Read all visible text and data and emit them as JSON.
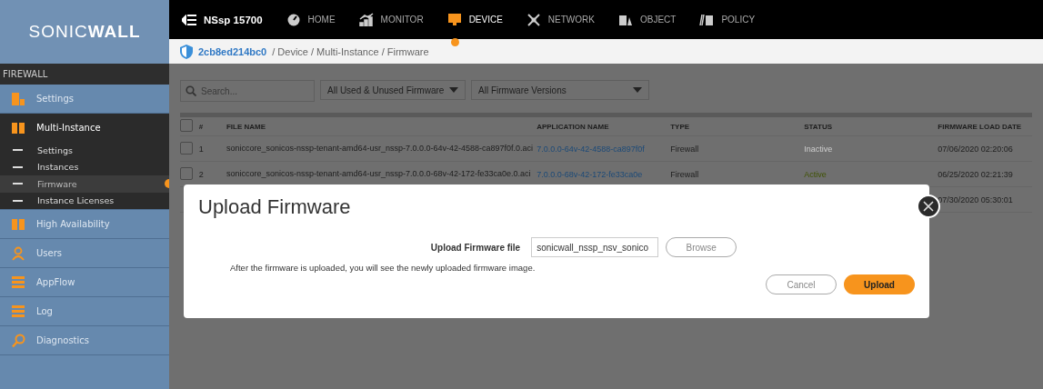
{
  "logo": "SONIC**WALL**",
  "topbar": {
    "device": "NSsp 15700",
    "tabs": [
      {
        "label": "HOME",
        "selected": false
      },
      {
        "label": "MONITOR",
        "selected": false
      },
      {
        "label": "DEVICE",
        "selected": true
      },
      {
        "label": "NETWORK",
        "selected": false
      },
      {
        "label": "OBJECT",
        "selected": false
      },
      {
        "label": "POLICY",
        "selected": false
      }
    ]
  },
  "breadcrumb": {
    "node": "2cb8ed214bc0",
    "trail": "/ Device / Multi-Instance / Firmware"
  },
  "sidebar": {
    "section": "FIREWALL",
    "items": [
      {
        "label": "Settings",
        "expanded": false
      },
      {
        "label": "Multi-Instance",
        "expanded": true,
        "children": [
          {
            "label": "Settings",
            "selected": false
          },
          {
            "label": "Instances",
            "selected": false
          },
          {
            "label": "Firmware",
            "selected": true
          },
          {
            "label": "Instance Licenses",
            "selected": false
          }
        ]
      },
      {
        "label": "High Availability",
        "expanded": false
      },
      {
        "label": "Users",
        "expanded": false
      },
      {
        "label": "AppFlow",
        "expanded": false
      },
      {
        "label": "Log",
        "expanded": false
      },
      {
        "label": "Diagnostics",
        "expanded": false
      }
    ]
  },
  "filters": {
    "search_placeholder": "Search...",
    "usage": "All Used & Unused Firmware",
    "versions": "All Firmware Versions"
  },
  "table": {
    "header_checked": false,
    "columns": [
      "#",
      "FILE NAME",
      "APPLICATION NAME",
      "TYPE",
      "STATUS",
      "FIRMWARE LOAD DATE"
    ],
    "rows": [
      {
        "checked": false,
        "index": "1",
        "file": "soniccore_sonicos-nssp-tenant-amd64-usr_nssp-7.0.0.0-64v-42-4588-ca897f0f.0.aci",
        "app": "7.0.0.0-64v-42-4588-ca897f0f",
        "type": "Firewall",
        "status": "Inactive",
        "active": false,
        "date": "07/06/2020 02:20:06"
      },
      {
        "checked": false,
        "index": "2",
        "file": "soniccore_sonicos-nssp-tenant-amd64-usr_nssp-7.0.0.0-68v-42-172-fe33ca0e.0.aci",
        "app": "7.0.0.0-68v-42-172-fe33ca0e",
        "type": "Firewall",
        "status": "Active",
        "active": true,
        "date": "06/25/2020 02:21:39"
      },
      {
        "date": "07/30/2020 05:30:01"
      }
    ]
  },
  "dialog": {
    "title": "Upload Firmware",
    "field_label": "Upload Firmware file",
    "field_value": "sonicwall_nssp_nsv_sonico",
    "browse": "Browse",
    "note": "After the firmware is uploaded, you will see the newly uploaded firmware image.",
    "cancel": "Cancel",
    "upload": "Upload"
  }
}
